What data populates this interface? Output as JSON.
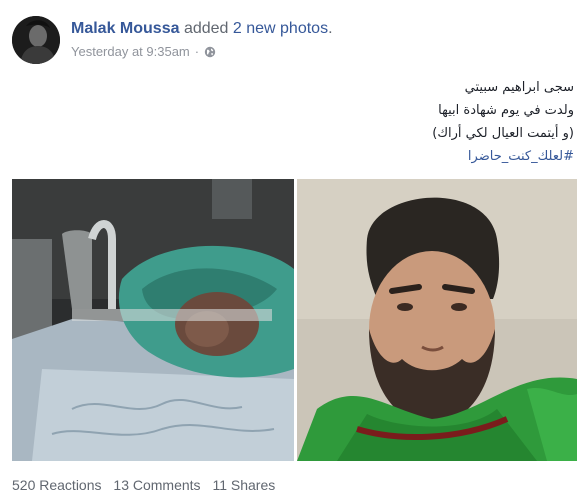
{
  "post": {
    "author": "Malak Moussa",
    "action_prefix": "added",
    "action_link": "2 new photos",
    "action_suffix": ".",
    "timestamp": "Yesterday at 9:35am",
    "separator": "·",
    "privacy_icon": "globe-icon",
    "text_lines": [
      "سجى ابراهيم سبيتي",
      "ولدت في يوم شهادة ابيها",
      "(و أيتمت العيال لكي أراك)",
      "#لعلك_كنت_حاضرا"
    ]
  },
  "photos": [
    {
      "name": "newborn-photo",
      "icon": "newborn-in-blanket"
    },
    {
      "name": "portrait-photo",
      "icon": "man-with-green-scarf"
    }
  ],
  "stats": {
    "reactions": "520 Reactions",
    "comments": "13 Comments",
    "shares": "11 Shares"
  },
  "colors": {
    "link": "#365899",
    "meta": "#90949c",
    "text": "#1d2129",
    "green_blanket": "#3e9a8a",
    "green_scarf": "#2e9a3a"
  }
}
